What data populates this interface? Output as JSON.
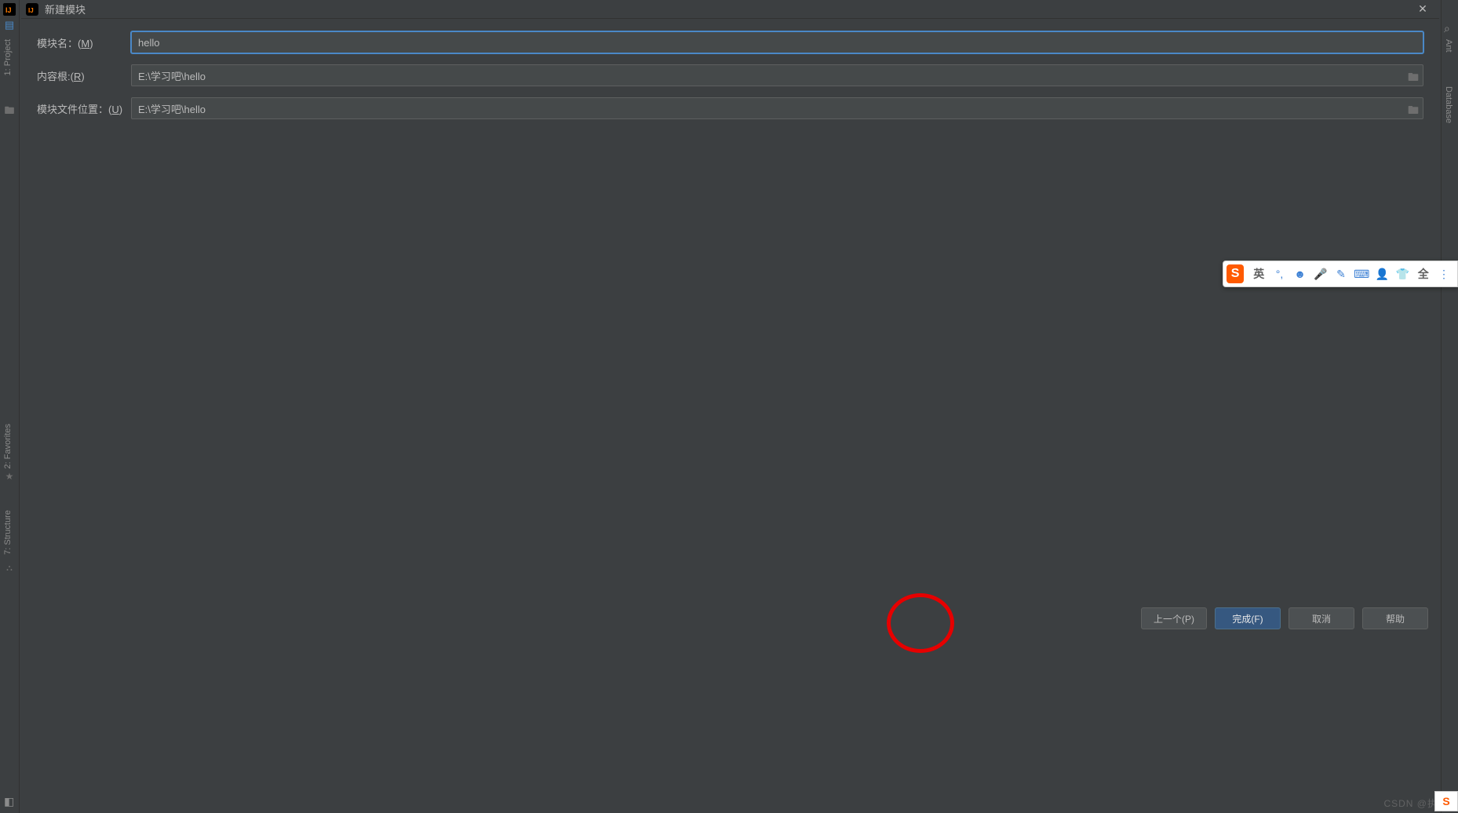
{
  "window": {
    "title": "新建模块"
  },
  "leftRail": {
    "project": "1: Project",
    "favorites": "2: Favorites",
    "structure": "7: Structure"
  },
  "rightRail": {
    "ant": "Ant",
    "database": "Database"
  },
  "form": {
    "moduleName": {
      "label": "模块名：(",
      "mnemonic": "M",
      "labelEnd": ")",
      "value": "hello"
    },
    "contentRoot": {
      "label": "内容根:(",
      "mnemonic": "R",
      "labelEnd": ")",
      "value": "E:\\学习吧\\hello"
    },
    "moduleFileLoc": {
      "label": "模块文件位置：(",
      "mnemonic": "U",
      "labelEnd": ")",
      "value": "E:\\学习吧\\hello"
    }
  },
  "buttons": {
    "prev": "上一个(P)",
    "finish": "完成(F)",
    "cancel": "取消",
    "help": "帮助"
  },
  "ime": {
    "logo": "S",
    "lang": "英",
    "punct": "°,",
    "full": "全"
  },
  "watermark": "CSDN @执念斩"
}
